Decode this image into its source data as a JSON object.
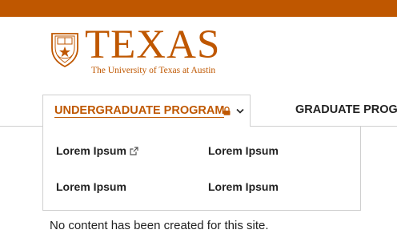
{
  "brand": {
    "accent_color": "#bf5700",
    "wordmark": "TEXAS",
    "tagline": "The University of Texas at Austin",
    "seal_icon": "ut-seal-icon"
  },
  "nav": {
    "items": [
      {
        "label": "UNDERGRADUATE PROGRAM",
        "locked": true,
        "expanded": true,
        "icons": [
          "lock-icon",
          "chevron-down-icon"
        ]
      },
      {
        "label": "GRADUATE PROGR"
      }
    ]
  },
  "dropdown": {
    "items": [
      {
        "label": "Lorem Ipsum",
        "external": true,
        "icon": "external-link-icon"
      },
      {
        "label": "Lorem Ipsum"
      },
      {
        "label": "Lorem Ipsum"
      },
      {
        "label": "Lorem Ipsum"
      }
    ]
  },
  "main": {
    "message": "No content has been created for this site."
  }
}
